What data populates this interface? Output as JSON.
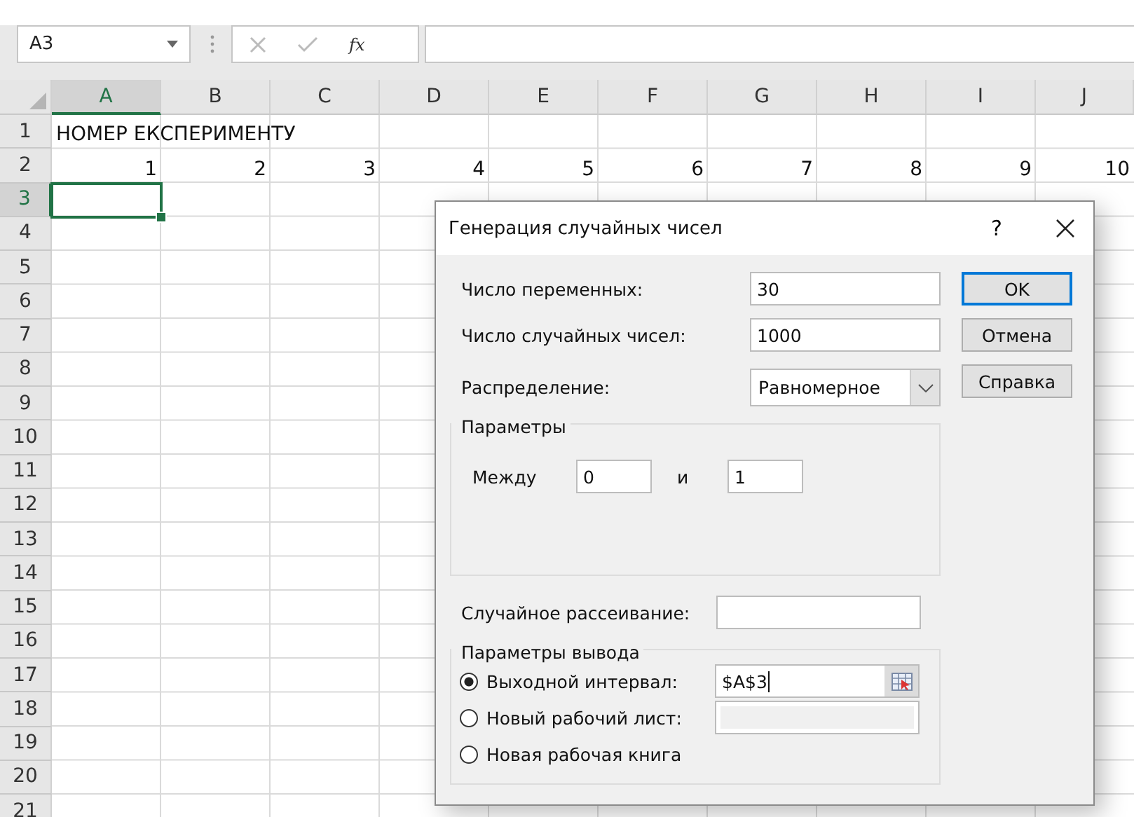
{
  "name_box": {
    "value": "A3"
  },
  "formula_bar": {
    "function_label": "fx"
  },
  "columns": [
    {
      "label": "A",
      "selected": true
    },
    {
      "label": "B",
      "selected": false
    },
    {
      "label": "C",
      "selected": false
    },
    {
      "label": "D",
      "selected": false
    },
    {
      "label": "E",
      "selected": false
    },
    {
      "label": "F",
      "selected": false
    },
    {
      "label": "G",
      "selected": false
    },
    {
      "label": "H",
      "selected": false
    },
    {
      "label": "I",
      "selected": false
    },
    {
      "label": "J",
      "selected": false
    }
  ],
  "rows": [
    {
      "label": "1",
      "selected": false,
      "cells": [
        {
          "kind": "text",
          "text": "НОМЕР ЕКСПЕРИМЕНТУ"
        }
      ]
    },
    {
      "label": "2",
      "selected": false,
      "cells": [
        {
          "kind": "number",
          "text": "1"
        },
        {
          "kind": "number",
          "text": "2"
        },
        {
          "kind": "number",
          "text": "3"
        },
        {
          "kind": "number",
          "text": "4"
        },
        {
          "kind": "number",
          "text": "5"
        },
        {
          "kind": "number",
          "text": "6"
        },
        {
          "kind": "number",
          "text": "7"
        },
        {
          "kind": "number",
          "text": "8"
        },
        {
          "kind": "number",
          "text": "9"
        },
        {
          "kind": "number",
          "text": "10"
        }
      ]
    },
    {
      "label": "3",
      "selected": true
    },
    {
      "label": "4",
      "selected": false
    },
    {
      "label": "5",
      "selected": false
    },
    {
      "label": "6",
      "selected": false
    },
    {
      "label": "7",
      "selected": false
    },
    {
      "label": "8",
      "selected": false
    },
    {
      "label": "9",
      "selected": false
    },
    {
      "label": "10",
      "selected": false
    },
    {
      "label": "11",
      "selected": false
    },
    {
      "label": "12",
      "selected": false
    },
    {
      "label": "13",
      "selected": false
    },
    {
      "label": "14",
      "selected": false
    },
    {
      "label": "15",
      "selected": false
    },
    {
      "label": "16",
      "selected": false
    },
    {
      "label": "17",
      "selected": false
    },
    {
      "label": "18",
      "selected": false
    },
    {
      "label": "19",
      "selected": false
    },
    {
      "label": "20",
      "selected": false
    },
    {
      "label": "21",
      "selected": false
    }
  ],
  "dialog": {
    "title": "Генерация случайных чисел",
    "help": "?",
    "fields": [
      {
        "label": "Число переменных:",
        "value": "30"
      },
      {
        "label": "Число случайных чисел:",
        "value": "1000"
      }
    ],
    "distribution": {
      "label": "Распределение:",
      "value": "Равномерное"
    },
    "buttons": [
      {
        "label": "OK",
        "default": true
      },
      {
        "label": "Отмена",
        "default": false
      },
      {
        "label": "Справка",
        "default": false
      }
    ],
    "parameters": {
      "title": "Параметры",
      "between_label": "Между",
      "from": "0",
      "and_label": "и",
      "to": "1"
    },
    "random_seed": {
      "label": "Случайное рассеивание:"
    },
    "output": {
      "title": "Параметры вывода",
      "options": [
        {
          "kind": "range",
          "label": "Выходной интервал:",
          "selected": true,
          "value": "$A$3"
        },
        {
          "kind": "sheet",
          "label": "Новый рабочий лист:",
          "selected": false,
          "field_disabled": true
        },
        {
          "kind": "book",
          "label": "Новая рабочая книга",
          "selected": false
        }
      ]
    }
  }
}
